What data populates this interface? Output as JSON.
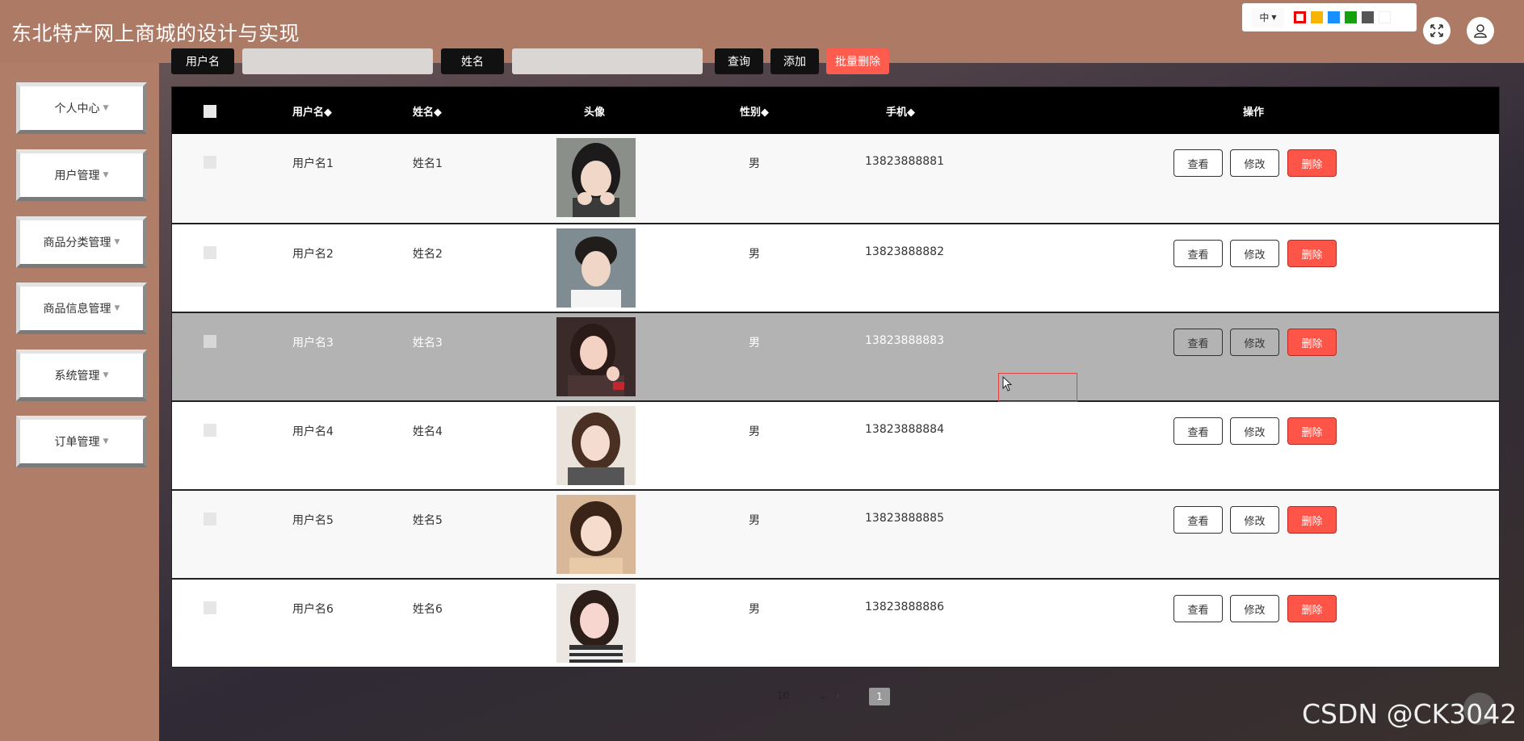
{
  "header": {
    "title": "东北特产网上商城的设计与实现",
    "language": "中",
    "theme_colors": [
      "#e00000",
      "#f7b500",
      "#1890ff",
      "#13a10e",
      "#555555",
      "#ffffff"
    ]
  },
  "sidebar": {
    "items": [
      {
        "label": "个人中心"
      },
      {
        "label": "用户管理"
      },
      {
        "label": "商品分类管理"
      },
      {
        "label": "商品信息管理"
      },
      {
        "label": "系统管理"
      },
      {
        "label": "订单管理"
      }
    ]
  },
  "toolbar": {
    "search_label_1": "用户名",
    "search_label_2": "姓名",
    "query_label": "查询",
    "add_label": "添加",
    "batch_delete_label": "批量删除"
  },
  "table": {
    "columns": [
      "用户名",
      "姓名",
      "头像",
      "性别",
      "手机",
      "操作"
    ],
    "sort_mark": "◆",
    "actions": {
      "view": "查看",
      "edit": "修改",
      "delete": "删除"
    },
    "rows": [
      {
        "username": "用户名1",
        "name": "姓名1",
        "gender": "男",
        "phone": "13823888881"
      },
      {
        "username": "用户名2",
        "name": "姓名2",
        "gender": "男",
        "phone": "13823888882"
      },
      {
        "username": "用户名3",
        "name": "姓名3",
        "gender": "男",
        "phone": "13823888883"
      },
      {
        "username": "用户名4",
        "name": "姓名4",
        "gender": "男",
        "phone": "13823888884"
      },
      {
        "username": "用户名5",
        "name": "姓名5",
        "gender": "男",
        "phone": "13823888885"
      },
      {
        "username": "用户名6",
        "name": "姓名6",
        "gender": "男",
        "phone": "13823888886"
      }
    ]
  },
  "pagination": {
    "page_size": "10",
    "current_page": "1"
  },
  "watermark": "CSDN @CK3042"
}
